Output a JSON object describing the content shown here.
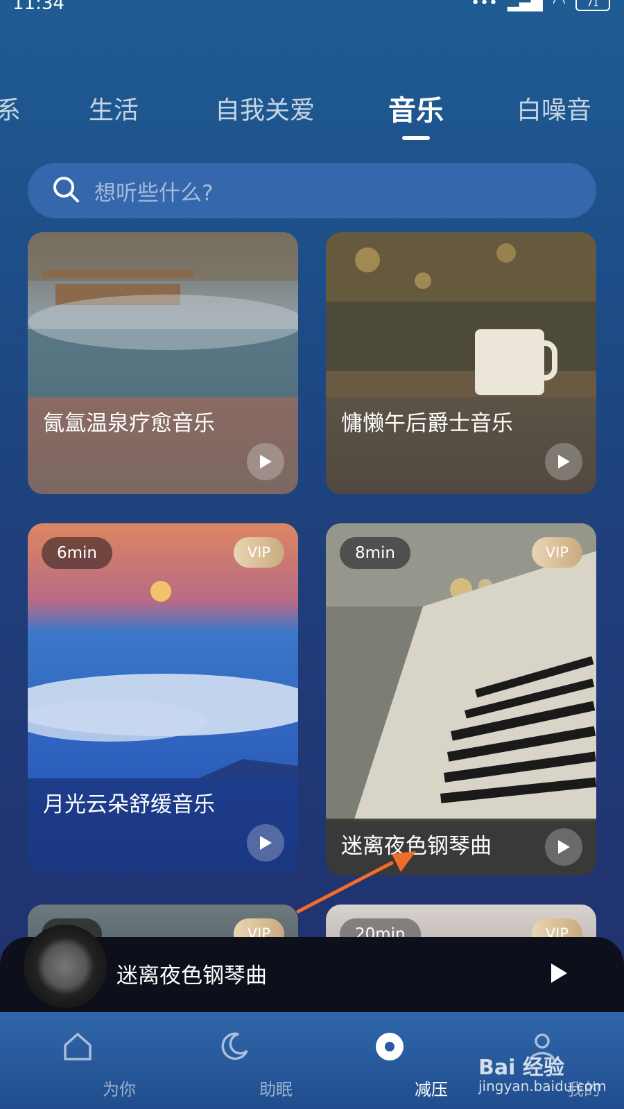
{
  "status_bar": {
    "time": "11:34",
    "battery": "71"
  },
  "tabs": [
    {
      "label": "系",
      "active": false
    },
    {
      "label": "生活",
      "active": false
    },
    {
      "label": "自我关爱",
      "active": false
    },
    {
      "label": "音乐",
      "active": true
    },
    {
      "label": "白噪音",
      "active": false
    }
  ],
  "search": {
    "placeholder": "想听些什么?"
  },
  "cards": [
    {
      "title": "氤氲温泉疗愈音乐"
    },
    {
      "title": "慵懒午后爵士音乐"
    },
    {
      "title": "月光云朵舒缓音乐",
      "duration": "6min",
      "badge": "VIP"
    },
    {
      "title": "迷离夜色钢琴曲",
      "duration": "8min",
      "badge": "VIP"
    },
    {
      "title": "",
      "duration": "min",
      "badge": "VIP"
    },
    {
      "title": "",
      "duration": "20min",
      "badge": "VIP"
    }
  ],
  "mini_player": {
    "title": "迷离夜色钢琴曲"
  },
  "bottom_nav": [
    {
      "label": "为你",
      "icon": "home-icon",
      "active": false
    },
    {
      "label": "助眠",
      "icon": "moon-icon",
      "active": false
    },
    {
      "label": "减压",
      "icon": "relax-icon",
      "active": true
    },
    {
      "label": "我的",
      "icon": "profile-icon",
      "active": false
    }
  ],
  "watermark": {
    "brand": "Bai 经验",
    "url": "jingyan.baidu.com"
  },
  "colors": {
    "accent_arrow": "#f26c2a",
    "vip_gold": "#d9bd90"
  }
}
